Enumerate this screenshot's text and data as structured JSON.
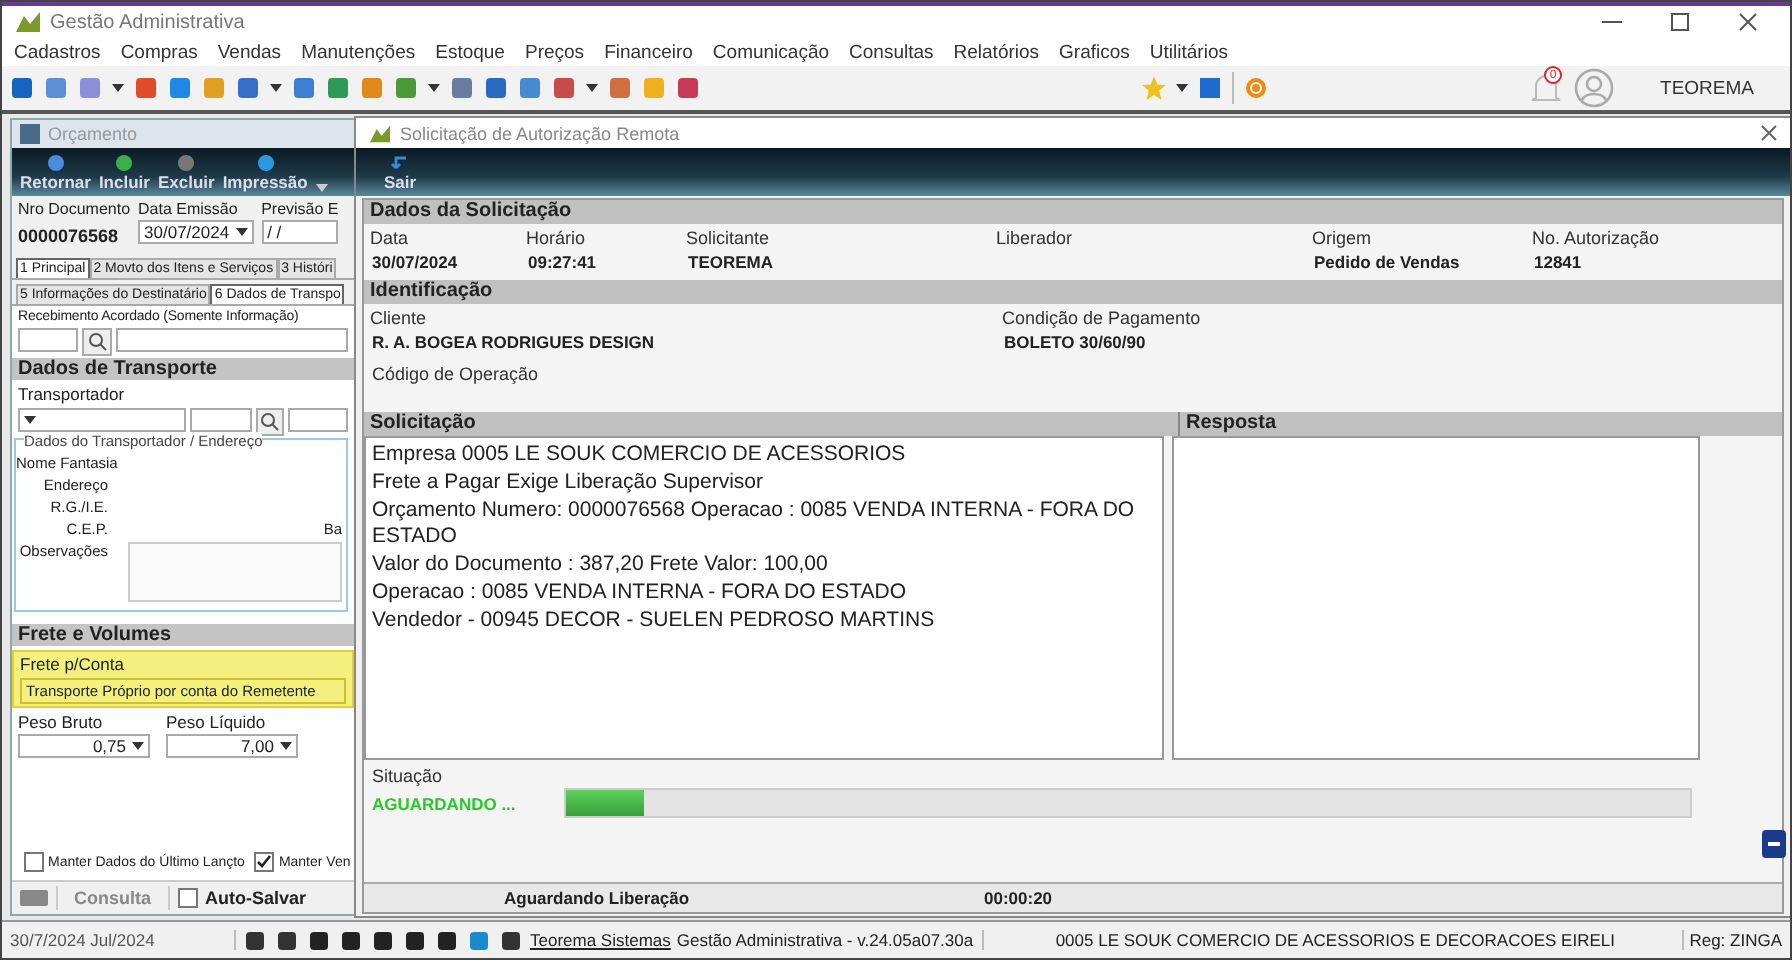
{
  "window": {
    "title": "Gestão Administrativa"
  },
  "menu": [
    "Cadastros",
    "Compras",
    "Vendas",
    "Manutenções",
    "Estoque",
    "Preços",
    "Financeiro",
    "Comunicação",
    "Consultas",
    "Relatórios",
    "Graficos",
    "Utilitários"
  ],
  "user_area": {
    "notifications": "0",
    "user": "TEOREMA"
  },
  "orcamento": {
    "title": "Orçamento",
    "actions": [
      "Retornar",
      "Incluir",
      "Excluir",
      "Impressão"
    ],
    "fields": [
      {
        "label": "Nro Documento",
        "value": "0000076568",
        "kind": "plain"
      },
      {
        "label": "Data Emissão",
        "value": "30/07/2024",
        "kind": "dropdown"
      },
      {
        "label": "Previsão E",
        "value": "/ /",
        "kind": "input"
      }
    ],
    "tabs_row_1": [
      {
        "label": "1 Principal",
        "selected": true
      },
      {
        "label": "2 Movto dos Itens e Serviços",
        "selected": false
      },
      {
        "label": "3 Históri",
        "selected": false
      }
    ],
    "tabs_row_2": [
      {
        "label": "5 Informações do Destinatário",
        "selected": false
      },
      {
        "label": "6 Dados de Transpo",
        "selected": true
      }
    ],
    "recebimento_label": "Recebimento Acordado (Somente Informação)",
    "transport_section": "Dados de Transporte",
    "transportador_label": "Transportador",
    "group_title": "Dados do Transportador / Endereço",
    "address_labels": [
      "Nome Fantasia",
      "Endereço",
      "R.G./I.E.",
      "C.E.P.",
      "Observações"
    ],
    "bairro_label": "Ba",
    "frete_section": "Frete e Volumes",
    "frete_label": "Frete p/Conta",
    "frete_value": "Transporte Próprio por conta do Remetente",
    "peso_bruto": {
      "label": "Peso Bruto",
      "value": "0,75"
    },
    "peso_liquido": {
      "label": "Peso Líquido",
      "value": "7,00"
    },
    "checkboxes": [
      {
        "label": "Manter Dados do Último Lançto",
        "checked": false
      },
      {
        "label": "Manter Ven",
        "checked": true
      }
    ],
    "consulta": "Consulta",
    "auto_salvar": {
      "label": "Auto-Salvar",
      "checked": false
    }
  },
  "dialog": {
    "title": "Solicitação de Autorização Remota",
    "action": "Sair",
    "dados_title": "Dados da Solicitação",
    "dados": [
      {
        "label": "Data",
        "value": "30/07/2024"
      },
      {
        "label": "Horário",
        "value": "09:27:41"
      },
      {
        "label": "Solicitante",
        "value": "TEOREMA"
      },
      {
        "label": "Liberador"
      },
      {
        "label": "Origem",
        "value": "Pedido de Vendas"
      },
      {
        "label": "No. Autorização",
        "value": "12841"
      }
    ],
    "identificacao_title": "Identificação",
    "cliente": {
      "label": "Cliente",
      "value": "R. A. BOGEA RODRIGUES DESIGN"
    },
    "pagamento": {
      "label": "Condição de Pagamento",
      "value": "BOLETO 30/60/90"
    },
    "operacao_label": "Código de Operação",
    "solicitacao_title": "Solicitação",
    "resposta_title": "Resposta",
    "solicitacao_lines": [
      "Empresa 0005 LE SOUK COMERCIO DE ACESSORIOS",
      "Frete a Pagar Exige Liberação Supervisor",
      "Orçamento Numero: 0000076568 Operacao : 0085 VENDA INTERNA - FORA DO ESTADO",
      "Valor do Documento : 387,20 Frete Valor: 100,00",
      "Operacao : 0085 VENDA INTERNA - FORA DO ESTADO",
      "Vendedor - 00945 DECOR - SUELEN PEDROSO MARTINS"
    ],
    "situacao_label": "Situação",
    "situacao_value": "AGUARDANDO ...",
    "progress": {
      "level": 0.07
    },
    "status_text": "Aguardando Liberação",
    "elapsed": "00:00:20"
  },
  "status_bar": {
    "date": "30/7/2024 Jul/2024",
    "link": "Teorema Sistemas",
    "version": "Gestão Administrativa - v.24.05a07.30a",
    "company": "0005 LE SOUK COMERCIO DE ACESSORIOS E DECORACOES EIRELI",
    "reg": "Reg: ZINGA"
  }
}
